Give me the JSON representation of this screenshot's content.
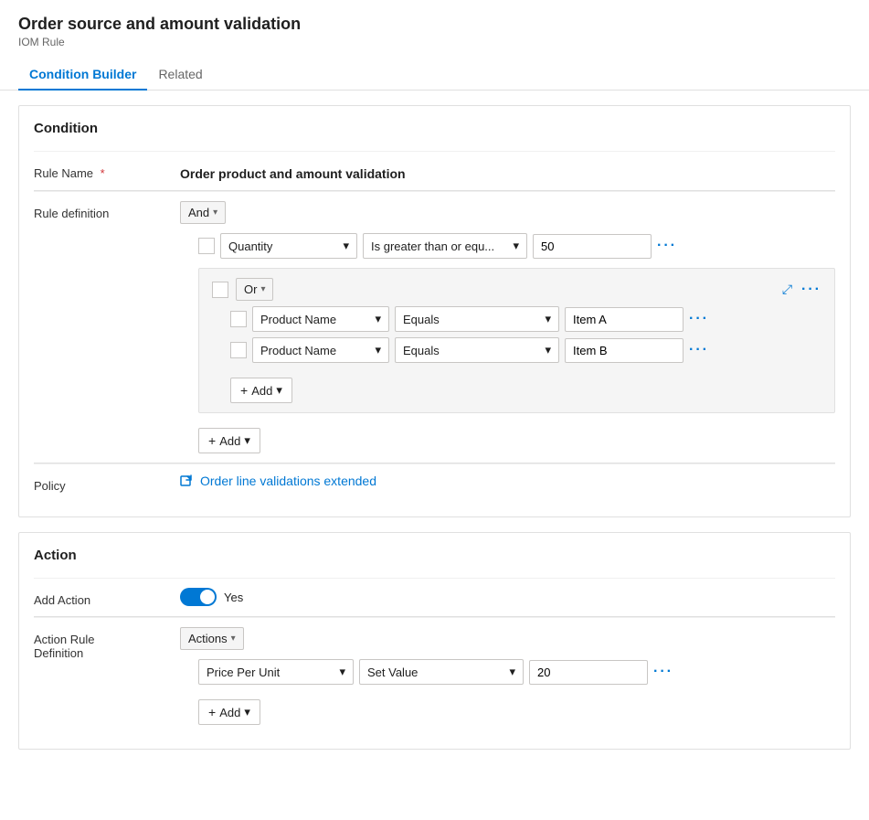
{
  "header": {
    "title": "Order source and amount validation",
    "subtitle": "IOM Rule"
  },
  "tabs": [
    {
      "id": "condition-builder",
      "label": "Condition Builder",
      "active": true
    },
    {
      "id": "related",
      "label": "Related",
      "active": false
    }
  ],
  "condition_section": {
    "title": "Condition",
    "rule_name_label": "Rule Name",
    "rule_name_required": "*",
    "rule_name_value": "Order product and amount validation",
    "rule_definition_label": "Rule definition",
    "and_operator": "And",
    "quantity_row": {
      "field": "Quantity",
      "operator": "Is greater than or equ...",
      "value": "50"
    },
    "or_group": {
      "operator": "Or",
      "rows": [
        {
          "field": "Product Name",
          "operator": "Equals",
          "value": "Item A"
        },
        {
          "field": "Product Name",
          "operator": "Equals",
          "value": "Item B"
        }
      ],
      "add_button": "+ Add"
    },
    "add_button": "+ Add",
    "policy_label": "Policy",
    "policy_link_text": "Order line validations extended"
  },
  "action_section": {
    "title": "Action",
    "add_action_label": "Add Action",
    "toggle_value": "Yes",
    "action_rule_def_label": "Action Rule\nDefinition",
    "actions_operator": "Actions",
    "action_row": {
      "field": "Price Per Unit",
      "operator": "Set Value",
      "value": "20"
    },
    "add_button": "+ Add"
  },
  "icons": {
    "chevron_down": "▾",
    "plus": "+",
    "three_dots": "···",
    "collapse": "⤢",
    "policy_icon": "🔗"
  }
}
